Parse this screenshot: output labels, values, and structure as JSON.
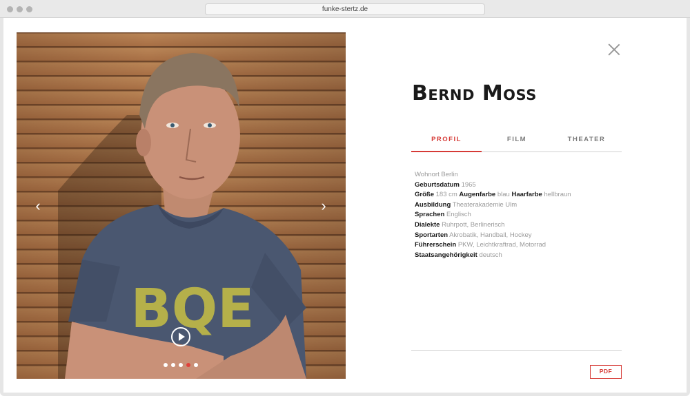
{
  "browser": {
    "url": "funke-stertz.de"
  },
  "person": {
    "name": "Bernd Moss"
  },
  "tabs": [
    {
      "label": "PROFIL",
      "active": true
    },
    {
      "label": "FILM",
      "active": false
    },
    {
      "label": "THEATER",
      "active": false
    }
  ],
  "profile": {
    "wohnort": "Wohnort Berlin",
    "geburtsdatum_label": "Geburtsdatum",
    "geburtsdatum": "1965",
    "groesse_label": "Größe",
    "groesse": "183 cm",
    "augenfarbe_label": "Augenfarbe",
    "augenfarbe": "blau",
    "haarfarbe_label": "Haarfarbe",
    "haarfarbe": "hellbraun",
    "ausbildung_label": "Ausbildung",
    "ausbildung": "Theaterakademie Ulm",
    "sprachen_label": "Sprachen",
    "sprachen": "Englisch",
    "dialekte_label": "Dialekte",
    "dialekte": "Ruhrpott, Berlinerisch",
    "sportarten_label": "Sportarten",
    "sportarten": "Akrobatik, Handball, Hockey",
    "fuehrerschein_label": "Führerschein",
    "fuehrerschein": "PKW, Leichtkraftrad, Motorrad",
    "staat_label": "Staatsangehörigkeit",
    "staat": "deutsch"
  },
  "gallery": {
    "prev_icon": "chevron-left-icon",
    "next_icon": "chevron-right-icon",
    "play_icon": "play-icon",
    "slide_count": 5,
    "active_slide": 4,
    "shirt_text": "BQE"
  },
  "actions": {
    "pdf_label": "PDF"
  },
  "colors": {
    "accent": "#d63a36",
    "text": "#1a1a1a",
    "muted": "#9a9a9a"
  }
}
